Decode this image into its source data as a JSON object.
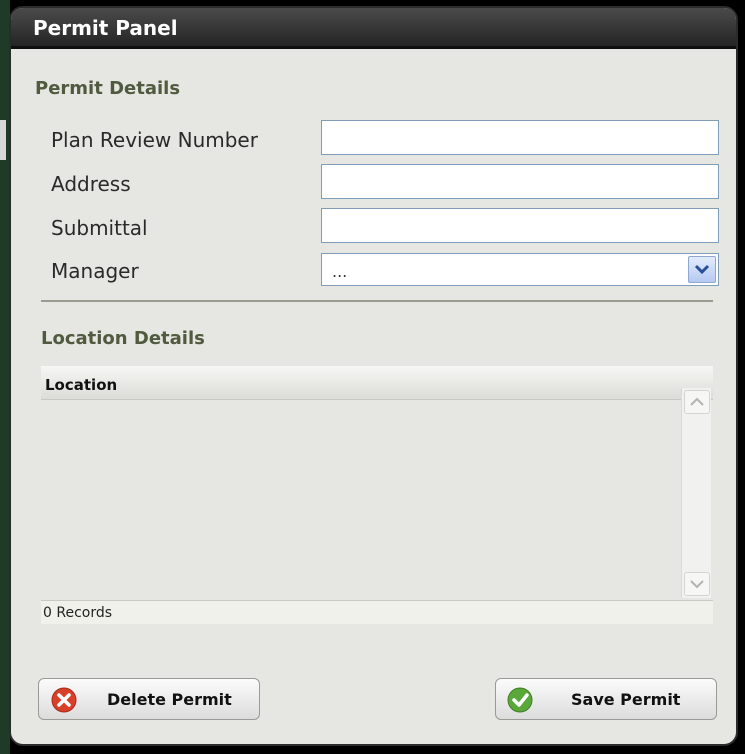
{
  "window": {
    "title": "Permit Panel"
  },
  "permit_details": {
    "heading": "Permit Details",
    "fields": [
      {
        "label": "Plan Review Number",
        "value": ""
      },
      {
        "label": "Address",
        "value": ""
      },
      {
        "label": "Submittal",
        "value": ""
      }
    ],
    "manager": {
      "label": "Manager",
      "selected": "..."
    }
  },
  "location_details": {
    "heading": "Location Details",
    "column_header": "Location",
    "rows": [],
    "record_count": "0 Records"
  },
  "actions": {
    "delete_label": "Delete Permit",
    "save_label": "Save Permit"
  },
  "colors": {
    "delete_icon": "#d9402a",
    "save_icon": "#5aa83a",
    "section_heading": "#4f5a3f"
  },
  "icons": {
    "delete": "x-circle-icon",
    "save": "check-circle-icon",
    "dropdown": "chevron-down-icon",
    "scroll_up": "chevron-up-icon",
    "scroll_down": "chevron-down-icon"
  }
}
